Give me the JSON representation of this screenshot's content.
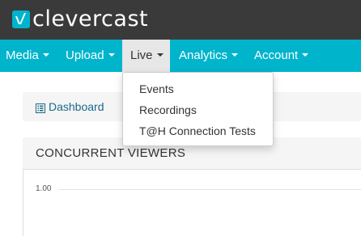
{
  "brand": {
    "logo_text": "clevercast",
    "logo_icon": "logo-mark-icon",
    "colors": {
      "topbar": "#3a3a3a",
      "accent": "#00b4cc"
    }
  },
  "nav": {
    "items": [
      {
        "label": "Media"
      },
      {
        "label": "Upload"
      },
      {
        "label": "Live"
      },
      {
        "label": "Analytics"
      },
      {
        "label": "Account"
      }
    ],
    "active": "Live"
  },
  "live_menu": {
    "items": [
      {
        "label": "Events"
      },
      {
        "label": "Recordings"
      },
      {
        "label": "T@H Connection Tests"
      }
    ]
  },
  "breadcrumb": {
    "label": "Dashboard",
    "icon": "list-icon"
  },
  "panel": {
    "title": "CONCURRENT VIEWERS",
    "y_tick": "1.00"
  }
}
